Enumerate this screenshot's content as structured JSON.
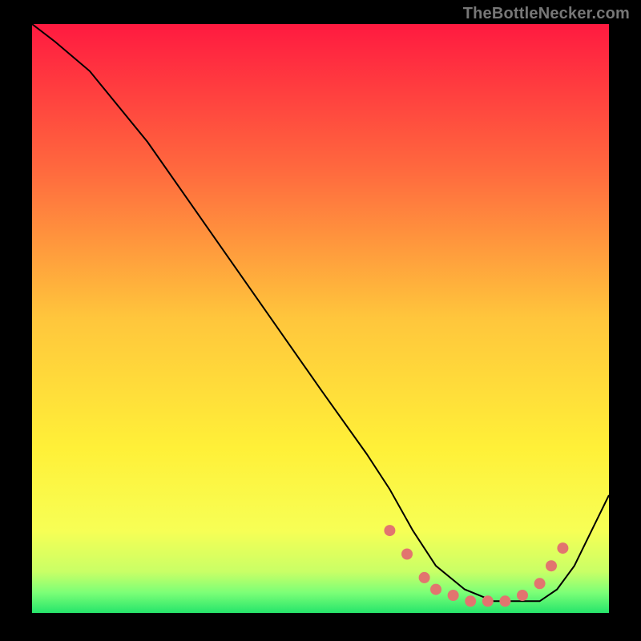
{
  "watermark": "TheBottleNecker.com",
  "chart_data": {
    "type": "line",
    "title": "",
    "xlabel": "",
    "ylabel": "",
    "xlim": [
      0,
      100
    ],
    "ylim": [
      0,
      100
    ],
    "grid": false,
    "legend": false,
    "annotations": [],
    "background_gradient": {
      "type": "vertical",
      "stops": [
        {
          "offset": 0.0,
          "color": "#ff1a40"
        },
        {
          "offset": 0.25,
          "color": "#ff6a3e"
        },
        {
          "offset": 0.5,
          "color": "#ffc63c"
        },
        {
          "offset": 0.72,
          "color": "#fff038"
        },
        {
          "offset": 0.86,
          "color": "#f7ff55"
        },
        {
          "offset": 0.93,
          "color": "#c9ff66"
        },
        {
          "offset": 0.965,
          "color": "#7dff77"
        },
        {
          "offset": 1.0,
          "color": "#26e56b"
        }
      ]
    },
    "series": [
      {
        "name": "curve",
        "type": "line",
        "stroke": "#000000",
        "stroke_width": 2,
        "x": [
          0,
          4,
          10,
          20,
          30,
          40,
          50,
          58,
          62,
          66,
          70,
          75,
          80,
          84,
          88,
          91,
          94,
          97,
          100
        ],
        "y": [
          100,
          97,
          92,
          80,
          66,
          52,
          38,
          27,
          21,
          14,
          8,
          4,
          2,
          2,
          2,
          4,
          8,
          14,
          20
        ]
      },
      {
        "name": "bead-markers",
        "type": "scatter",
        "marker_color": "#e2746f",
        "marker_radius": 7,
        "x": [
          62,
          65,
          68,
          70,
          73,
          76,
          79,
          82,
          85,
          88,
          90,
          92
        ],
        "y": [
          14,
          10,
          6,
          4,
          3,
          2,
          2,
          2,
          3,
          5,
          8,
          11
        ]
      }
    ]
  }
}
